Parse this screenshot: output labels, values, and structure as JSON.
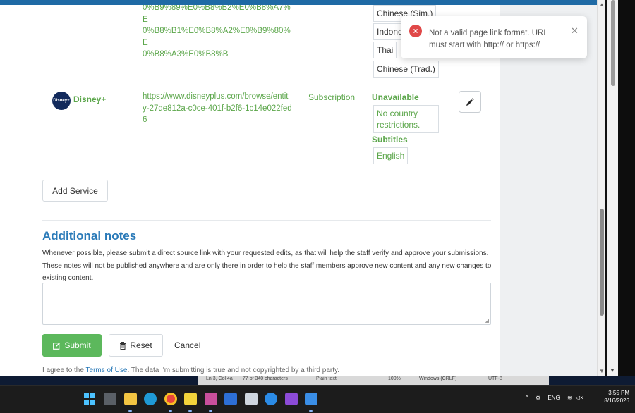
{
  "rows": {
    "prev": {
      "url_lines": [
        "0%B9%89%E0%B8%B2%E0%B8%A7%E",
        "0%B8%B1%E0%B8%A2%E0%B9%80%E",
        "0%B8%A3%E0%B8%B"
      ],
      "languages": [
        "Chinese (Sim.)",
        "Indone",
        "Thai",
        "Chinese (Trad.)"
      ]
    },
    "disney": {
      "logo_text": "Disney+",
      "name": "Disney+",
      "url": "https://www.disneyplus.com/browse/entity-27de812a-c0ce-401f-b2f6-1c14e022fed6",
      "type": "Subscription",
      "availability_heading": "Unavailable",
      "availability_value": "No country restrictions.",
      "subtitles_heading": "Subtitles",
      "subtitles_value": "English",
      "edit_icon": "pencil-icon"
    }
  },
  "add_service_label": "Add Service",
  "notes": {
    "title": "Additional notes",
    "description": "Whenever possible, please submit a direct source link with your requested edits, as that will help the staff verify and approve your submissions. These notes will not be published anywhere and are only there in order to help the staff members approve new content and any new changes to existing content.",
    "textarea_value": ""
  },
  "actions": {
    "submit_label": "Submit",
    "reset_label": "Reset",
    "cancel_label": "Cancel"
  },
  "agreement": {
    "before": "I agree to the ",
    "link": "Terms of Use",
    "after": ". The data I'm submitting is true and not copyrighted by a third party."
  },
  "toast": {
    "message": "Not a valid page link format. URL must start with http:// or https://",
    "icon": "error-x-icon",
    "close_icon": "close-icon"
  },
  "behind_window": {
    "items": [
      "Ln 3, Col 4a",
      "77 of 340 characters",
      "Plain text",
      "100%",
      "Windows (CRLF)",
      "UTF-8"
    ]
  },
  "taskbar": {
    "language": "ENG",
    "time": "3:55 PM",
    "date": "8/16/2026"
  },
  "colors": {
    "accent_green": "#5ba64a",
    "title_blue": "#2a7ab8",
    "submit_green": "#5cb85c",
    "error_red": "#e04848"
  }
}
